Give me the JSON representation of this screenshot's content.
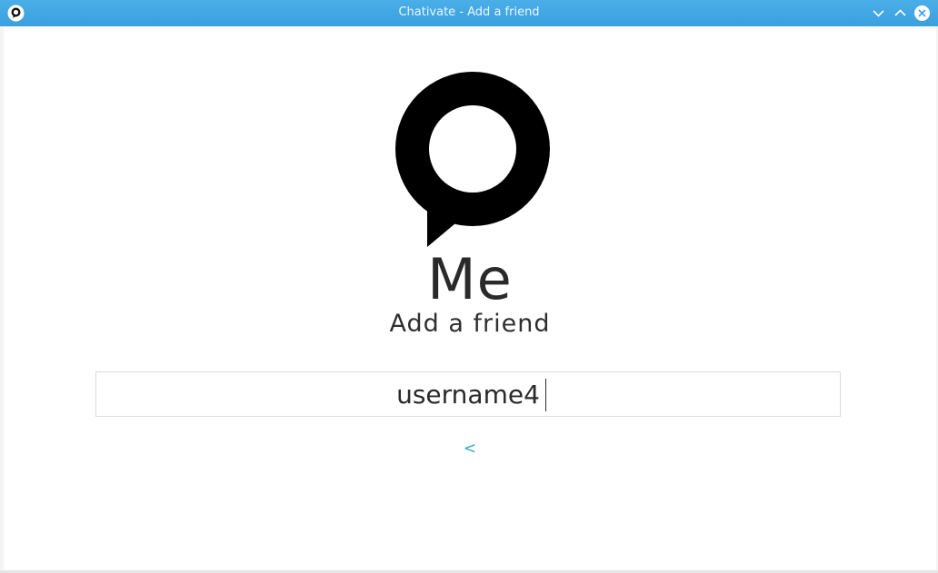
{
  "window": {
    "title": "Chativate - Add a friend"
  },
  "icons": {
    "app": "app-logo-icon",
    "minimize": "chevron-down-icon",
    "maximize": "chevron-up-icon",
    "close": "close-icon",
    "logo": "speech-bubble-logo"
  },
  "colors": {
    "titlebar": "#3aa0de",
    "link": "#2ea6c9",
    "text": "#2a2a2a"
  },
  "page": {
    "heading": "Me",
    "subheading": "Add a friend"
  },
  "form": {
    "username_value": "username4",
    "back_label": "<"
  }
}
